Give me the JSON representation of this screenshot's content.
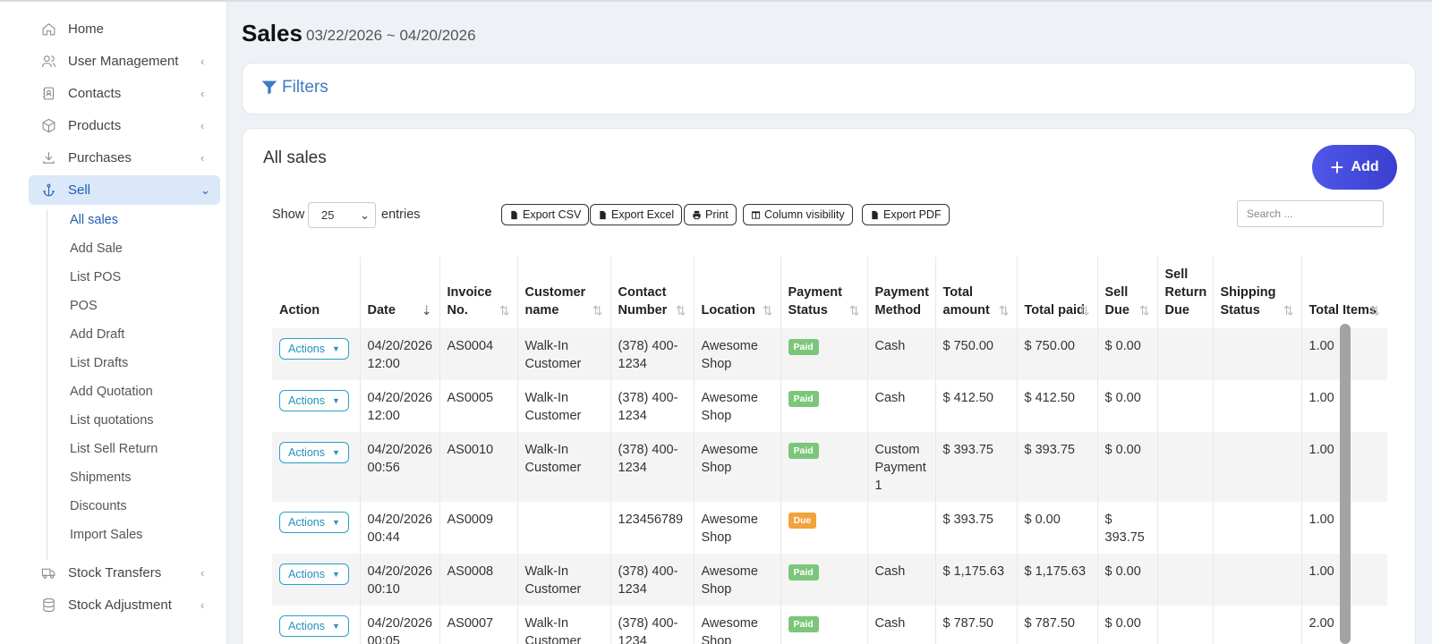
{
  "sidebar": {
    "items": [
      {
        "label": "Home",
        "icon": "home-icon",
        "chevron": ""
      },
      {
        "label": "User Management",
        "icon": "users-icon",
        "chevron": "‹"
      },
      {
        "label": "Contacts",
        "icon": "contacts-icon",
        "chevron": "‹"
      },
      {
        "label": "Products",
        "icon": "box-icon",
        "chevron": "‹"
      },
      {
        "label": "Purchases",
        "icon": "download-icon",
        "chevron": "‹"
      },
      {
        "label": "Sell",
        "icon": "anchor-icon",
        "chevron": "⌄"
      },
      {
        "label": "Stock Transfers",
        "icon": "truck-icon",
        "chevron": "‹"
      },
      {
        "label": "Stock Adjustment",
        "icon": "database-icon",
        "chevron": "‹"
      }
    ],
    "sell_submenu": [
      "All sales",
      "Add Sale",
      "List POS",
      "POS",
      "Add Draft",
      "List Drafts",
      "Add Quotation",
      "List quotations",
      "List Sell Return",
      "Shipments",
      "Discounts",
      "Import Sales"
    ]
  },
  "header": {
    "title": "Sales",
    "date_range": "03/22/2026 ~ 04/20/2026"
  },
  "filters": {
    "label": "Filters"
  },
  "card": {
    "title": "All sales",
    "add_label": "Add"
  },
  "controls": {
    "show_label": "Show",
    "page_size": "25",
    "entries_label": "entries",
    "export_csv": "Export CSV",
    "export_excel": "Export Excel",
    "print": "Print",
    "column_visibility": "Column visibility",
    "export_pdf": "Export PDF",
    "search_placeholder": "Search ..."
  },
  "table": {
    "columns": [
      "Action",
      "Date",
      "Invoice No.",
      "Customer name",
      "Contact Number",
      "Location",
      "Payment Status",
      "Payment Method",
      "Total amount",
      "Total paid",
      "Sell Due",
      "Sell Return Due",
      "Shipping Status",
      "Total Items"
    ],
    "action_label": "Actions",
    "rows": [
      {
        "date": "04/20/2026 12:00",
        "invoice": "AS0004",
        "customer": "Walk-In Customer",
        "contact": "(378) 400-1234",
        "location": "Awesome Shop",
        "status": "Paid",
        "method": "Cash",
        "total": "$ 750.00",
        "paid": "$ 750.00",
        "due": "$ 0.00",
        "return_due": "",
        "shipping": "",
        "items": "1.00"
      },
      {
        "date": "04/20/2026 12:00",
        "invoice": "AS0005",
        "customer": "Walk-In Customer",
        "contact": "(378) 400-1234",
        "location": "Awesome Shop",
        "status": "Paid",
        "method": "Cash",
        "total": "$ 412.50",
        "paid": "$ 412.50",
        "due": "$ 0.00",
        "return_due": "",
        "shipping": "",
        "items": "1.00"
      },
      {
        "date": "04/20/2026 00:56",
        "invoice": "AS0010",
        "customer": "Walk-In Customer",
        "contact": "(378) 400-1234",
        "location": "Awesome Shop",
        "status": "Paid",
        "method": "Custom Payment 1",
        "total": "$ 393.75",
        "paid": "$ 393.75",
        "due": "$ 0.00",
        "return_due": "",
        "shipping": "",
        "items": "1.00"
      },
      {
        "date": "04/20/2026 00:44",
        "invoice": "AS0009",
        "customer": "",
        "contact": "123456789",
        "location": "Awesome Shop",
        "status": "Due",
        "method": "",
        "total": "$ 393.75",
        "paid": "$ 0.00",
        "due": "$ 393.75",
        "return_due": "",
        "shipping": "",
        "items": "1.00"
      },
      {
        "date": "04/20/2026 00:10",
        "invoice": "AS0008",
        "customer": "Walk-In Customer",
        "contact": "(378) 400-1234",
        "location": "Awesome Shop",
        "status": "Paid",
        "method": "Cash",
        "total": "$ 1,175.63",
        "paid": "$ 1,175.63",
        "due": "$ 0.00",
        "return_due": "",
        "shipping": "",
        "items": "1.00"
      },
      {
        "date": "04/20/2026 00:05",
        "invoice": "AS0007",
        "customer": "Walk-In Customer",
        "contact": "(378) 400-1234",
        "location": "Awesome Shop",
        "status": "Paid",
        "method": "Cash",
        "total": "$ 787.50",
        "paid": "$ 787.50",
        "due": "$ 0.00",
        "return_due": "",
        "shipping": "",
        "items": "2.00"
      }
    ]
  },
  "colors": {
    "accent": "#1f5eb0",
    "add_button": "#4f57e8",
    "paid": "#7cc67a",
    "due": "#f3a33b",
    "action_outline": "#2aa0c8"
  }
}
